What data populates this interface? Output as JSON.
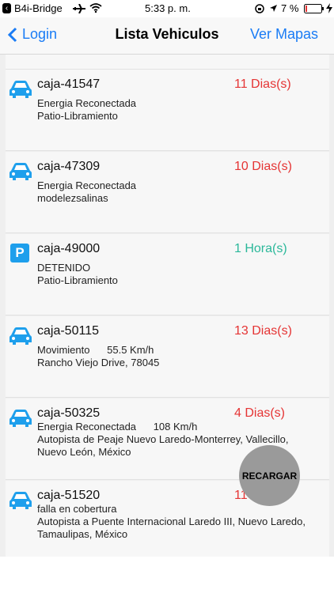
{
  "status": {
    "app_back": "B4i-Bridge",
    "time": "5:33 p. m.",
    "battery": "7 %"
  },
  "nav": {
    "back_label": "Login",
    "title": "Lista Vehiculos",
    "right_label": "Ver Mapas"
  },
  "vehicles": [
    {
      "name": "caja-41547",
      "duration": "11 Dias(s)",
      "line1": "Energia Reconectada",
      "line2": "Patio-Libramiento",
      "line3": "",
      "icon": "car-icon"
    },
    {
      "name": "caja-47309",
      "duration": "10 Dias(s)",
      "line1": "Energia Reconectada",
      "line2": "modelezsalinas",
      "line3": "",
      "icon": "car-icon"
    },
    {
      "name": "caja-49000",
      "duration": "1 Hora(s)",
      "line1": "DETENIDO",
      "line2": "Patio-Libramiento",
      "line3": "",
      "icon": "parking-icon"
    },
    {
      "name": "caja-50115",
      "duration": "13 Dias(s)",
      "line1": "Movimiento      55.5 Km/h",
      "line2": "Rancho Viejo Drive, 78045",
      "line3": "",
      "icon": "car-icon"
    },
    {
      "name": "caja-50325",
      "duration": "4 Dias(s)",
      "line1": "Energia Reconectada      108 Km/h",
      "line2": "Autopista de Peaje Nuevo Laredo-Monterrey, Vallecillo,",
      "line3": "Nuevo León, México",
      "icon": "car-icon"
    },
    {
      "name": "caja-51520",
      "duration": "11",
      "line1": "falla en cobertura",
      "line2": "Autopista a Puente Internacional Laredo III, Nuevo Laredo,",
      "line3": "Tamaulipas, México",
      "icon": "car-icon"
    }
  ],
  "fab_label": "RECARGAR",
  "colors": {
    "accent": "#1a7cf5",
    "red": "#e53434",
    "green": "#2bb89a",
    "icon_blue": "#1e9fec"
  }
}
